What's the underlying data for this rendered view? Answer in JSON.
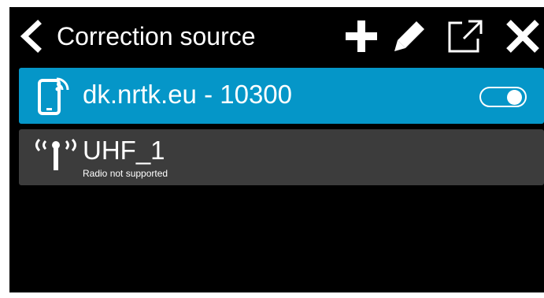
{
  "header": {
    "title": "Correction source",
    "back_icon": "chevron-left-icon",
    "actions": [
      {
        "name": "add",
        "icon": "plus-icon"
      },
      {
        "name": "edit",
        "icon": "pencil-icon"
      },
      {
        "name": "open-external",
        "icon": "external-link-icon"
      },
      {
        "name": "close",
        "icon": "close-icon"
      }
    ]
  },
  "sources": [
    {
      "name": "dk.nrtk.eu - 10300",
      "icon": "mobile-signal-icon",
      "enabled": true,
      "selected": true
    },
    {
      "name": "UHF_1",
      "subtitle": "Radio not supported",
      "icon": "radio-antenna-icon",
      "selected": false
    }
  ],
  "colors": {
    "background": "#000000",
    "selected_row": "#0596c8",
    "unselected_row": "#3c3c3c",
    "text": "#ffffff"
  }
}
